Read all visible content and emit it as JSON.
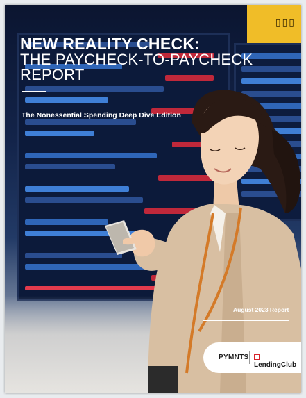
{
  "cover": {
    "title_line1": "NEW REALITY CHECK:",
    "title_line2": "THE PAYCHECK-TO-PAYCHECK REPORT",
    "subtitle": "The Nonessential Spending Deep Dive Edition",
    "date": "August 2023 Report"
  },
  "logos": {
    "pymnts": "PYMNTS",
    "lendingclub": "LendingClub"
  },
  "colors": {
    "board_blue": "#0c1a3a",
    "sign_yellow": "#f0bd28",
    "lendingclub_red": "#d7242b",
    "coat_beige": "#d8bfa2"
  }
}
